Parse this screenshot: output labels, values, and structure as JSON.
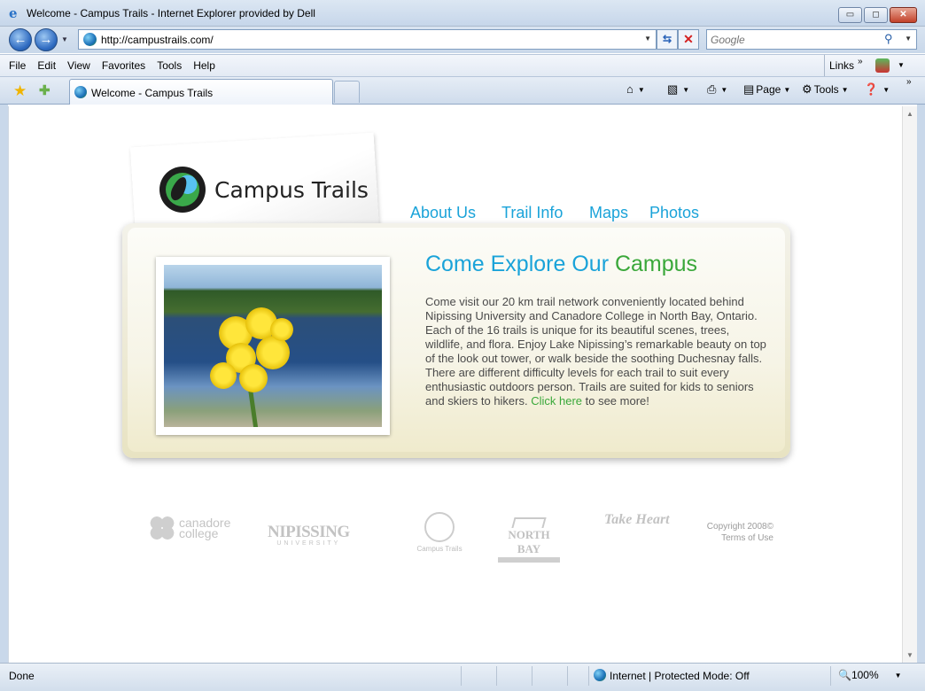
{
  "window": {
    "title": "Welcome - Campus Trails - Internet Explorer provided by Dell",
    "min_symbol": "▭",
    "max_symbol": "◻",
    "close_symbol": "✕"
  },
  "address_bar": {
    "url": "http://campustrails.com/",
    "search_placeholder": "Google"
  },
  "menu": {
    "items": [
      "File",
      "Edit",
      "View",
      "Favorites",
      "Tools",
      "Help"
    ],
    "links_label": "Links"
  },
  "tabs": {
    "active_tab_label": "Welcome - Campus Trails"
  },
  "command_bar": {
    "page_label": "Page",
    "tools_label": "Tools"
  },
  "site": {
    "logo_text": "Campus Trails",
    "nav": [
      "About Us",
      "Trail Info",
      "Maps",
      "Photos"
    ],
    "heading_part1": "Come Explore Our ",
    "heading_part2": "Campus",
    "body": "Come visit our 20 km trail network conveniently located behind Nipissing University and Canadore College in North Bay, Ontario. Each of the 16 trails is unique for its beautiful scenes, trees, wildlife, and flora. Enjoy Lake Nipissing’s remarkable beauty on top of the look out tower, or walk beside the soothing Duchesnay falls. There are different difficulty levels for each trail to suit every enthusiastic outdoors person. Trails are suited for kids to seniors and skiers to hikers. ",
    "click_here": "Click here",
    "body_end": " to see more!",
    "footer": {
      "canadore": "canadore college",
      "nipissing": "NIPISSING",
      "nipissing_sub": "UNIVERSITY",
      "campus_trails": "Campus Trails",
      "north_bay": "NORTH BAY",
      "take_heart": "Take Heart",
      "copyright": "Copyright 2008©",
      "terms": "Terms of Use"
    }
  },
  "status_bar": {
    "status": "Done",
    "zone": "Internet | Protected Mode: Off",
    "zoom": "100%"
  },
  "colors": {
    "site_blue": "#1aa3d9",
    "site_green": "#3aa83a",
    "panel_cream": "#f0ebcd"
  }
}
